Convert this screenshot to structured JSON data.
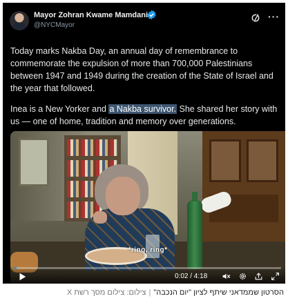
{
  "tweet": {
    "author_name": "Mayor Zohran Kwame Mamdani",
    "handle": "@NYCMayor",
    "para1": "Today marks Nakba Day, an annual day of remembrance to commemorate the expulsion of more than 700,000 Palestinians between 1947 and 1949 during the creation of the State of Israel and the year that followed.",
    "para2_before": "Inea is a New Yorker and ",
    "para2_highlight": "a Nakba survivor.",
    "para2_after": " She shared her story with us — one of home, tradition and memory over generations.",
    "verified_color": "#1d9bf0"
  },
  "video": {
    "subtitle": "*ring, ring*",
    "current_time": "0:02",
    "duration": "4:18",
    "time_display": "0:02 / 4:18",
    "progress_fraction": 0.008,
    "icons": [
      "play-icon",
      "mute-icon",
      "settings-icon",
      "share-icon",
      "fullscreen-icon"
    ]
  },
  "credit": {
    "caption": "הסרטון שממדאני שיתף לציון \"יום הנכבה\"",
    "source": "צילום: צילום מסך רשת X"
  },
  "colors": {
    "tweet_bg": "#000000",
    "highlight": "#3d5670",
    "accent": "#1d9bf0"
  }
}
